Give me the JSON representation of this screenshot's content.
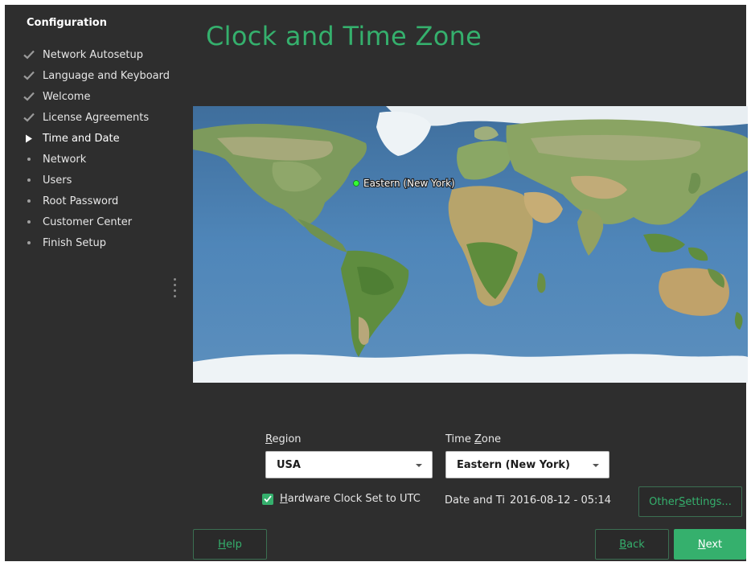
{
  "sidebar": {
    "title": "Configuration",
    "steps": [
      {
        "label": "Network Autosetup",
        "state": "done"
      },
      {
        "label": "Language and Keyboard",
        "state": "done"
      },
      {
        "label": "Welcome",
        "state": "done"
      },
      {
        "label": "License Agreements",
        "state": "done"
      },
      {
        "label": "Time and Date",
        "state": "current"
      },
      {
        "label": "Network",
        "state": "pending"
      },
      {
        "label": "Users",
        "state": "pending"
      },
      {
        "label": "Root Password",
        "state": "pending"
      },
      {
        "label": "Customer Center",
        "state": "pending"
      },
      {
        "label": "Finish Setup",
        "state": "pending"
      }
    ]
  },
  "page": {
    "title": "Clock and Time Zone"
  },
  "map": {
    "selected_label": "Eastern (New York)"
  },
  "region": {
    "label_prefix": "",
    "label_mnemonic": "R",
    "label_rest": "egion",
    "value": "USA"
  },
  "timezone": {
    "label_prefix": "Time ",
    "label_mnemonic": "Z",
    "label_rest": "one",
    "value": "Eastern (New York)"
  },
  "hardware_clock": {
    "label_mnemonic": "H",
    "label_rest": "ardware Clock Set to UTC",
    "checked": true
  },
  "datetime": {
    "label": "Date and Time",
    "value": "2016-08-12 - 05:14"
  },
  "buttons": {
    "other_settings_prefix": "Other ",
    "other_settings_mnemonic": "S",
    "other_settings_rest": "ettings...",
    "help_mnemonic": "H",
    "help_rest": "elp",
    "back_mnemonic": "B",
    "back_rest": "ack",
    "next_mnemonic": "N",
    "next_rest": "ext"
  },
  "colors": {
    "accent": "#35b06d",
    "background": "#2e2e2e"
  }
}
